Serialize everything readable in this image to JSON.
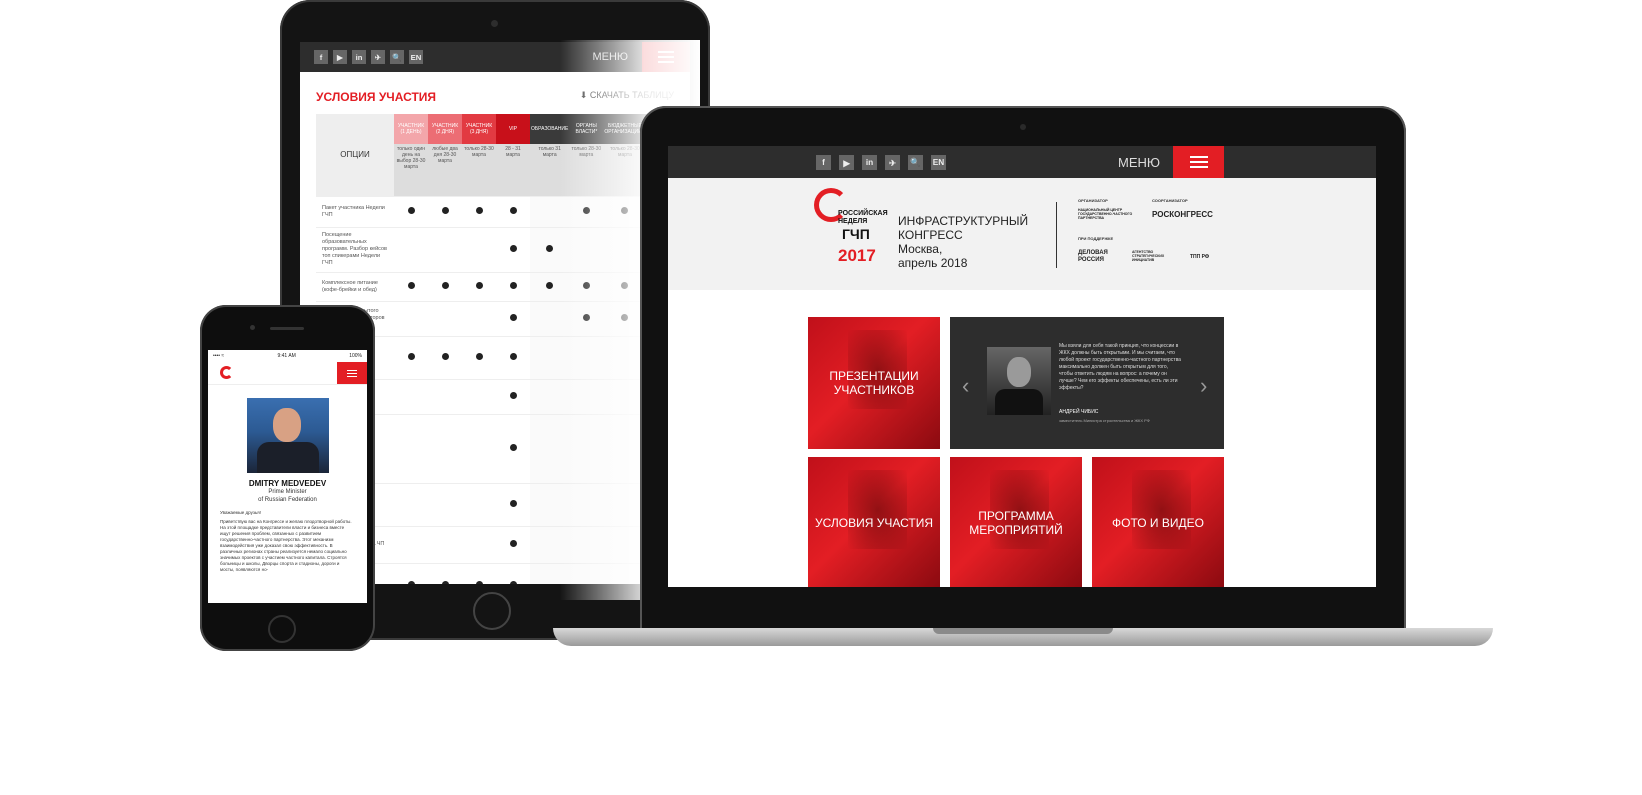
{
  "tablet": {
    "social": [
      "f",
      "▶",
      "in",
      "✈",
      "🔍",
      "EN"
    ],
    "menu": "МЕНЮ",
    "title": "УСЛОВИЯ УЧАСТИЯ",
    "download": "⬇ СКАЧАТЬ ТАБЛИЦУ",
    "options_label": "ОПЦИИ",
    "columns": [
      {
        "name": "УЧАСТНИК (1 ДЕНЬ)",
        "color": "#f3a6aa",
        "sub": "только один день на выбор 28-30 марта"
      },
      {
        "name": "УЧАСТНИК (2 ДНЯ)",
        "color": "#ec6d74",
        "sub": "любые два дня 28-30 марта"
      },
      {
        "name": "УЧАСТНИК (3 ДНЯ)",
        "color": "#e23a42",
        "sub": "только 28-30 марта"
      },
      {
        "name": "VIP",
        "color": "#c8101a",
        "sub": "28 - 31 марта"
      },
      {
        "name": "ОБРАЗОВАНИЕ",
        "color": "#3a3a3a",
        "sub": "только 31 марта"
      },
      {
        "name": "ОРГАНЫ ВЛАСТИ*",
        "color": "#3a3a3a",
        "sub": "только 28-30 марта"
      },
      {
        "name": "БЮДЖЕТНЫЕ ОРГАНИЗАЦИИ**",
        "color": "#3a3a3a",
        "sub": "только 28-30 марта"
      }
    ],
    "rows": [
      {
        "label": "Пакет участника Недели ГЧП",
        "marks": [
          1,
          1,
          1,
          1,
          0,
          1,
          1
        ]
      },
      {
        "label": "Посещение образовательных программ. Разбор кейсов топ спикерами Недели ГЧП",
        "marks": [
          0,
          0,
          0,
          1,
          1,
          0,
          0
        ]
      },
      {
        "label": "Комплексное питание (кофе-брейки и обед)",
        "marks": [
          1,
          1,
          1,
          1,
          1,
          1,
          1
        ]
      },
      {
        "label": "Посещение закрытого ужина от Организаторов Недели ГЧП",
        "marks": [
          0,
          0,
          0,
          1,
          0,
          1,
          1
        ]
      },
      {
        "label": "…ансов",
        "marks": [
          1,
          1,
          1,
          1,
          0,
          0,
          0
        ]
      },
      {
        "label": "…зали …ного",
        "marks": [
          0,
          0,
          0,
          1,
          0,
          0,
          0
        ]
      },
      {
        "label": "…ЧП …актов",
        "marks": [
          0,
          0,
          0,
          1,
          0,
          0,
          0
        ]
      },
      {
        "label": "…мации …и",
        "marks": [
          0,
          0,
          0,
          1,
          0,
          0,
          0
        ]
      },
      {
        "label": "…мации …альном …ЧП",
        "marks": [
          0,
          0,
          0,
          1,
          0,
          0,
          0
        ]
      },
      {
        "label": "…ного …по теме",
        "marks": [
          1,
          1,
          1,
          1,
          0,
          0,
          0
        ]
      }
    ]
  },
  "phone": {
    "time": "9:41 AM",
    "battery": "100%",
    "name": "DMITRY MEDVEDEV",
    "role1": "Prime Minister",
    "role2": "of Russian Federation",
    "greeting": "Уважаемые друзья!",
    "body": "Приветствую вас на Конгрессе и желаю плодотворной работы. На этой площадке представители власти и бизнеса вместе ищут решения проблем, связанных с развитием государственно-частного партнерства. Этот механизм взаимодействия уже доказал свою эффективность. В различных регионах страны реализуется немало социально значимых проектов с участием частного капитала. Строятся больницы и школы, Дворцы спорта и стадионы, дороги и мосты, появляются но-"
  },
  "laptop": {
    "social": [
      "f",
      "▶",
      "in",
      "✈",
      "🔍",
      "EN"
    ],
    "menu": "МЕНЮ",
    "logo": {
      "line1": "РОССИЙСКАЯ",
      "line2": "НЕДЕЛЯ",
      "line3": "ГЧП",
      "year": "2017"
    },
    "congress": [
      "ИНФРАСТРУКТУРНЫЙ",
      "КОНГРЕСС",
      "Москва,",
      "апрель 2018"
    ],
    "organizer_label": "ОРГАНИЗАТОР",
    "coorganizer_label": "СООРГАНИЗАТОР",
    "support_label": "ПРИ ПОДДЕРЖКЕ",
    "organizer": "НАЦИОНАЛЬНЫЙ ЦЕНТР ГОСУДАРСТВЕННО-ЧАСТНОГО ПАРТНЕРСТВА",
    "coorganizer": "РОСКОНГРЕСС",
    "supporters": [
      "ДЕЛОВАЯ РОССИЯ",
      "АГЕНТСТВО СТРАТЕГИЧЕСКИХ ИНИЦИАТИВ",
      "ТПП РФ"
    ],
    "tiles": {
      "presentations": "ПРЕЗЕНТАЦИИ УЧАСТНИКОВ",
      "conditions": "УСЛОВИЯ УЧАСТИЯ",
      "program": "ПРОГРАММА МЕРОПРИЯТИЙ",
      "media": "ФОТО И ВИДЕО"
    },
    "quote": {
      "text": "Мы взяли для себя такой принцип, что концессии в ЖКХ должны быть открытыми. И мы считаем, что любой проект государственно-частного партнерства максимально должен быть открытым для того, чтобы ответить людям на вопрос: а почему он лучше? Чем его эффекты обеспечены, есть ли эти эффекты?",
      "author": "АНДРЕЙ ЧИБИС",
      "role": "заместитель Министра строительства и ЖКХ РФ"
    },
    "colors": {
      "accent": "#e31e24",
      "dark": "#2d2d2d",
      "header_bg": "#f2f2f2"
    }
  }
}
